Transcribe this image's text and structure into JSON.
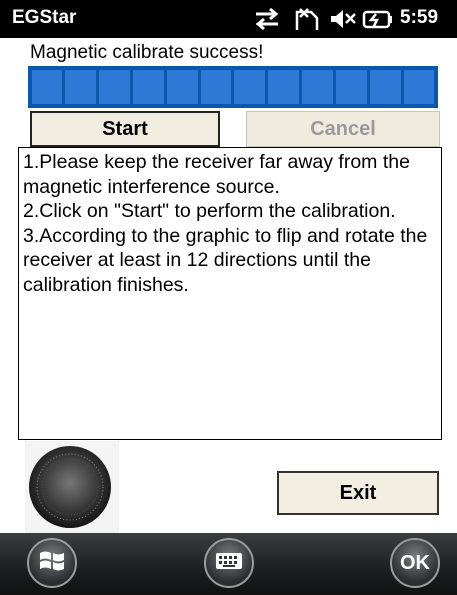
{
  "statusbar": {
    "app_title": "EGStar",
    "time": "5:59"
  },
  "calibration": {
    "message": "Magnetic calibrate success!",
    "progress": 1.0,
    "segments": 12
  },
  "buttons": {
    "start": "Start",
    "cancel": "Cancel",
    "exit": "Exit"
  },
  "instructions": [
    "1.Please keep the receiver far away from the magnetic interference source.",
    "2.Click on \"Start\" to perform the calibration.",
    "3.According to the graphic to flip and rotate the receiver at least in 12 directions until the calibration finishes."
  ],
  "taskbar": {
    "ok_label": "OK",
    "start_icon": "windows-logo-icon",
    "keyboard_icon": "keyboard-icon"
  },
  "colors": {
    "progress_fill": "#2f79d6",
    "progress_border": "#0a57ad"
  }
}
